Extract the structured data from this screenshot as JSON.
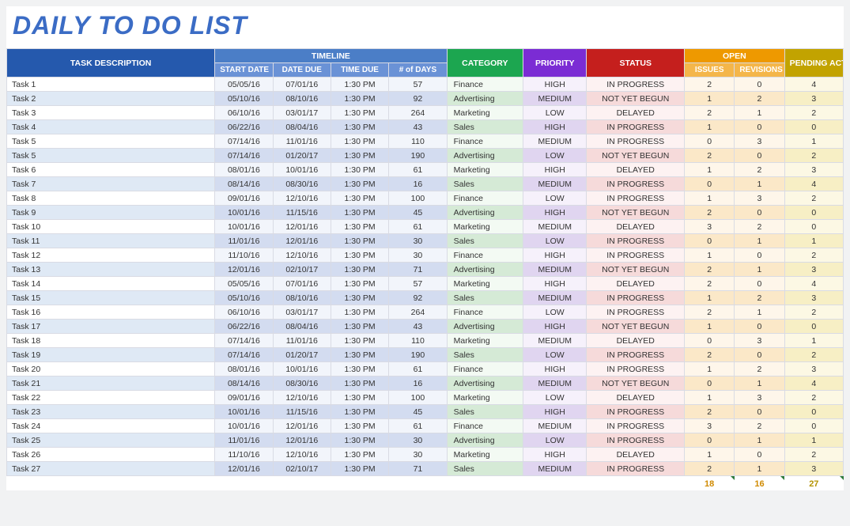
{
  "title": "DAILY TO DO LIST",
  "headers": {
    "desc": "TASK DESCRIPTION",
    "timeline": "TIMELINE",
    "category": "CATEGORY",
    "priority": "PRIORITY",
    "status": "STATUS",
    "open": "OPEN",
    "pending": "PENDING ACTIONS",
    "sub": {
      "start": "START DATE",
      "due": "DATE DUE",
      "time": "TIME DUE",
      "days": "# of DAYS",
      "issues": "ISSUES",
      "revisions": "REVISIONS"
    }
  },
  "totals": {
    "issues": "18",
    "revisions": "16",
    "pending": "27"
  },
  "rows": [
    {
      "task": "Task 1",
      "start": "05/05/16",
      "due": "07/01/16",
      "time": "1:30 PM",
      "days": "57",
      "cat": "Finance",
      "pri": "HIGH",
      "stat": "IN PROGRESS",
      "iss": "2",
      "rev": "0",
      "pend": "4"
    },
    {
      "task": "Task 2",
      "start": "05/10/16",
      "due": "08/10/16",
      "time": "1:30 PM",
      "days": "92",
      "cat": "Advertising",
      "pri": "MEDIUM",
      "stat": "NOT YET BEGUN",
      "iss": "1",
      "rev": "2",
      "pend": "3"
    },
    {
      "task": "Task 3",
      "start": "06/10/16",
      "due": "03/01/17",
      "time": "1:30 PM",
      "days": "264",
      "cat": "Marketing",
      "pri": "LOW",
      "stat": "DELAYED",
      "iss": "2",
      "rev": "1",
      "pend": "2"
    },
    {
      "task": "Task 4",
      "start": "06/22/16",
      "due": "08/04/16",
      "time": "1:30 PM",
      "days": "43",
      "cat": "Sales",
      "pri": "HIGH",
      "stat": "IN PROGRESS",
      "iss": "1",
      "rev": "0",
      "pend": "0"
    },
    {
      "task": "Task 5",
      "start": "07/14/16",
      "due": "11/01/16",
      "time": "1:30 PM",
      "days": "110",
      "cat": "Finance",
      "pri": "MEDIUM",
      "stat": "IN PROGRESS",
      "iss": "0",
      "rev": "3",
      "pend": "1"
    },
    {
      "task": "Task 5",
      "start": "07/14/16",
      "due": "01/20/17",
      "time": "1:30 PM",
      "days": "190",
      "cat": "Advertising",
      "pri": "LOW",
      "stat": "NOT YET BEGUN",
      "iss": "2",
      "rev": "0",
      "pend": "2"
    },
    {
      "task": "Task 6",
      "start": "08/01/16",
      "due": "10/01/16",
      "time": "1:30 PM",
      "days": "61",
      "cat": "Marketing",
      "pri": "HIGH",
      "stat": "DELAYED",
      "iss": "1",
      "rev": "2",
      "pend": "3"
    },
    {
      "task": "Task 7",
      "start": "08/14/16",
      "due": "08/30/16",
      "time": "1:30 PM",
      "days": "16",
      "cat": "Sales",
      "pri": "MEDIUM",
      "stat": "IN PROGRESS",
      "iss": "0",
      "rev": "1",
      "pend": "4"
    },
    {
      "task": "Task 8",
      "start": "09/01/16",
      "due": "12/10/16",
      "time": "1:30 PM",
      "days": "100",
      "cat": "Finance",
      "pri": "LOW",
      "stat": "IN PROGRESS",
      "iss": "1",
      "rev": "3",
      "pend": "2"
    },
    {
      "task": "Task 9",
      "start": "10/01/16",
      "due": "11/15/16",
      "time": "1:30 PM",
      "days": "45",
      "cat": "Advertising",
      "pri": "HIGH",
      "stat": "NOT YET BEGUN",
      "iss": "2",
      "rev": "0",
      "pend": "0"
    },
    {
      "task": "Task 10",
      "start": "10/01/16",
      "due": "12/01/16",
      "time": "1:30 PM",
      "days": "61",
      "cat": "Marketing",
      "pri": "MEDIUM",
      "stat": "DELAYED",
      "iss": "3",
      "rev": "2",
      "pend": "0"
    },
    {
      "task": "Task 11",
      "start": "11/01/16",
      "due": "12/01/16",
      "time": "1:30 PM",
      "days": "30",
      "cat": "Sales",
      "pri": "LOW",
      "stat": "IN PROGRESS",
      "iss": "0",
      "rev": "1",
      "pend": "1"
    },
    {
      "task": "Task 12",
      "start": "11/10/16",
      "due": "12/10/16",
      "time": "1:30 PM",
      "days": "30",
      "cat": "Finance",
      "pri": "HIGH",
      "stat": "IN PROGRESS",
      "iss": "1",
      "rev": "0",
      "pend": "2"
    },
    {
      "task": "Task 13",
      "start": "12/01/16",
      "due": "02/10/17",
      "time": "1:30 PM",
      "days": "71",
      "cat": "Advertising",
      "pri": "MEDIUM",
      "stat": "NOT YET BEGUN",
      "iss": "2",
      "rev": "1",
      "pend": "3"
    },
    {
      "task": "Task 14",
      "start": "05/05/16",
      "due": "07/01/16",
      "time": "1:30 PM",
      "days": "57",
      "cat": "Marketing",
      "pri": "HIGH",
      "stat": "DELAYED",
      "iss": "2",
      "rev": "0",
      "pend": "4"
    },
    {
      "task": "Task 15",
      "start": "05/10/16",
      "due": "08/10/16",
      "time": "1:30 PM",
      "days": "92",
      "cat": "Sales",
      "pri": "MEDIUM",
      "stat": "IN PROGRESS",
      "iss": "1",
      "rev": "2",
      "pend": "3"
    },
    {
      "task": "Task 16",
      "start": "06/10/16",
      "due": "03/01/17",
      "time": "1:30 PM",
      "days": "264",
      "cat": "Finance",
      "pri": "LOW",
      "stat": "IN PROGRESS",
      "iss": "2",
      "rev": "1",
      "pend": "2"
    },
    {
      "task": "Task 17",
      "start": "06/22/16",
      "due": "08/04/16",
      "time": "1:30 PM",
      "days": "43",
      "cat": "Advertising",
      "pri": "HIGH",
      "stat": "NOT YET BEGUN",
      "iss": "1",
      "rev": "0",
      "pend": "0"
    },
    {
      "task": "Task 18",
      "start": "07/14/16",
      "due": "11/01/16",
      "time": "1:30 PM",
      "days": "110",
      "cat": "Marketing",
      "pri": "MEDIUM",
      "stat": "DELAYED",
      "iss": "0",
      "rev": "3",
      "pend": "1"
    },
    {
      "task": "Task 19",
      "start": "07/14/16",
      "due": "01/20/17",
      "time": "1:30 PM",
      "days": "190",
      "cat": "Sales",
      "pri": "LOW",
      "stat": "IN PROGRESS",
      "iss": "2",
      "rev": "0",
      "pend": "2"
    },
    {
      "task": "Task 20",
      "start": "08/01/16",
      "due": "10/01/16",
      "time": "1:30 PM",
      "days": "61",
      "cat": "Finance",
      "pri": "HIGH",
      "stat": "IN PROGRESS",
      "iss": "1",
      "rev": "2",
      "pend": "3"
    },
    {
      "task": "Task 21",
      "start": "08/14/16",
      "due": "08/30/16",
      "time": "1:30 PM",
      "days": "16",
      "cat": "Advertising",
      "pri": "MEDIUM",
      "stat": "NOT YET BEGUN",
      "iss": "0",
      "rev": "1",
      "pend": "4"
    },
    {
      "task": "Task 22",
      "start": "09/01/16",
      "due": "12/10/16",
      "time": "1:30 PM",
      "days": "100",
      "cat": "Marketing",
      "pri": "LOW",
      "stat": "DELAYED",
      "iss": "1",
      "rev": "3",
      "pend": "2"
    },
    {
      "task": "Task 23",
      "start": "10/01/16",
      "due": "11/15/16",
      "time": "1:30 PM",
      "days": "45",
      "cat": "Sales",
      "pri": "HIGH",
      "stat": "IN PROGRESS",
      "iss": "2",
      "rev": "0",
      "pend": "0"
    },
    {
      "task": "Task 24",
      "start": "10/01/16",
      "due": "12/01/16",
      "time": "1:30 PM",
      "days": "61",
      "cat": "Finance",
      "pri": "MEDIUM",
      "stat": "IN PROGRESS",
      "iss": "3",
      "rev": "2",
      "pend": "0"
    },
    {
      "task": "Task 25",
      "start": "11/01/16",
      "due": "12/01/16",
      "time": "1:30 PM",
      "days": "30",
      "cat": "Advertising",
      "pri": "LOW",
      "stat": "IN PROGRESS",
      "iss": "0",
      "rev": "1",
      "pend": "1"
    },
    {
      "task": "Task 26",
      "start": "11/10/16",
      "due": "12/10/16",
      "time": "1:30 PM",
      "days": "30",
      "cat": "Marketing",
      "pri": "HIGH",
      "stat": "DELAYED",
      "iss": "1",
      "rev": "0",
      "pend": "2"
    },
    {
      "task": "Task 27",
      "start": "12/01/16",
      "due": "02/10/17",
      "time": "1:30 PM",
      "days": "71",
      "cat": "Sales",
      "pri": "MEDIUM",
      "stat": "IN PROGRESS",
      "iss": "2",
      "rev": "1",
      "pend": "3"
    }
  ]
}
